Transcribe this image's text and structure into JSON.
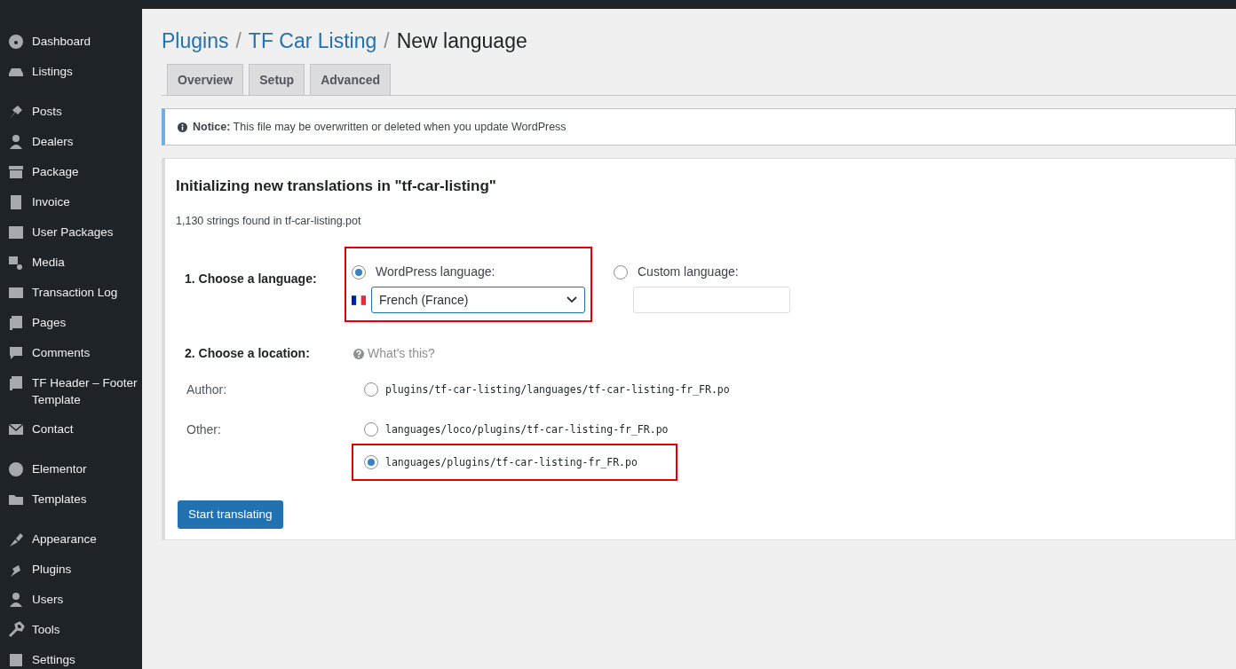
{
  "sidebar": {
    "groups": [
      [
        {
          "label": "Dashboard"
        },
        {
          "label": "Listings"
        }
      ],
      [
        {
          "label": "Posts"
        },
        {
          "label": "Dealers"
        },
        {
          "label": "Package"
        },
        {
          "label": "Invoice"
        },
        {
          "label": "User Packages"
        },
        {
          "label": "Media"
        },
        {
          "label": "Transaction Log"
        },
        {
          "label": "Pages"
        },
        {
          "label": "Comments"
        },
        {
          "label": "TF Header – Footer Template"
        },
        {
          "label": "Contact"
        }
      ],
      [
        {
          "label": "Elementor"
        },
        {
          "label": "Templates"
        }
      ],
      [
        {
          "label": "Appearance"
        },
        {
          "label": "Plugins"
        },
        {
          "label": "Users"
        },
        {
          "label": "Tools"
        },
        {
          "label": "Settings"
        }
      ]
    ]
  },
  "breadcrumb_separator": "/",
  "breadcrumb": [
    {
      "label": "Plugins",
      "link": true
    },
    {
      "label": "TF Car Listing",
      "link": true
    },
    {
      "label": "New language",
      "link": false
    }
  ],
  "tabs": [
    {
      "label": "Overview",
      "selected": false
    },
    {
      "label": "Setup",
      "selected": false
    },
    {
      "label": "Advanced",
      "selected": false
    }
  ],
  "notice": {
    "text": "**Notice:** This file may be overwritten or deleted when you update WordPress"
  },
  "card": {
    "title": "Initializing new translations in \"tf-car-listing\"",
    "summary": "1,130 strings found in tf-car-listing.pot",
    "language": {
      "label": "1. Choose a language:",
      "options": [
        {
          "label": "WordPress language:",
          "selected": true,
          "highlighted": true,
          "select_value": "French (France)"
        },
        {
          "label": "Custom language:",
          "selected": false,
          "highlighted": false
        }
      ]
    },
    "location": {
      "label": "2. Choose a location:",
      "help": "What's this?",
      "options": [
        {
          "group": "Author:",
          "path": "plugins/tf-car-listing/languages/tf-car-listing-fr_FR.po",
          "selected": false,
          "highlighted": false
        },
        {
          "group": "Other:",
          "path": "languages/loco/plugins/tf-car-listing-fr_FR.po",
          "selected": false,
          "highlighted": false
        },
        {
          "path": "languages/plugins/tf-car-listing-fr_FR.po",
          "selected": true,
          "highlighted": true
        }
      ]
    },
    "button": "Start translating"
  }
}
